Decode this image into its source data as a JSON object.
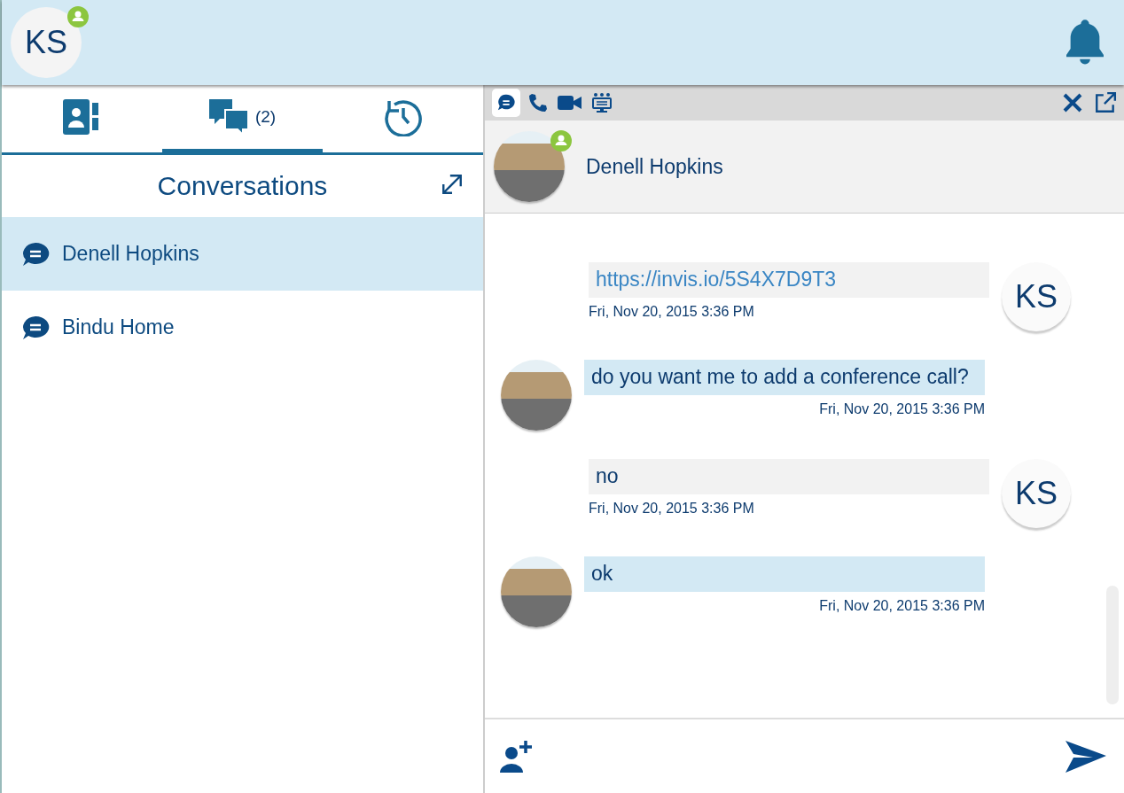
{
  "user": {
    "initials": "KS",
    "online": true
  },
  "tabs": [
    {
      "kind": "contacts",
      "selected": false
    },
    {
      "kind": "chat",
      "label": "(2)",
      "selected": true
    },
    {
      "kind": "history",
      "selected": false
    }
  ],
  "panel_title": "Conversations",
  "conversations": [
    {
      "name": "Denell Hopkins",
      "selected": true
    },
    {
      "name": "Bindu Home",
      "selected": false
    }
  ],
  "chat": {
    "modes": [
      {
        "kind": "chat",
        "selected": true
      },
      {
        "kind": "phone",
        "selected": false
      },
      {
        "kind": "video",
        "selected": false
      },
      {
        "kind": "conference",
        "selected": false
      }
    ],
    "contact": {
      "name": "Denell Hopkins",
      "online": true
    },
    "messages": [
      {
        "kind": "own",
        "text": "https://invis.io/5S4X7D9T3",
        "link": true,
        "time": "Fri, Nov 20, 2015 3:36 PM",
        "initials": "KS"
      },
      {
        "kind": "other",
        "text": "do you want me to add a conference call?",
        "link": false,
        "time": "Fri, Nov 20, 2015 3:36 PM"
      },
      {
        "kind": "own",
        "text": "no",
        "link": false,
        "time": "Fri, Nov 20, 2015 3:36 PM",
        "initials": "KS"
      },
      {
        "kind": "other",
        "text": "ok",
        "link": false,
        "time": "Fri, Nov 20, 2015 3:36 PM"
      }
    ]
  }
}
